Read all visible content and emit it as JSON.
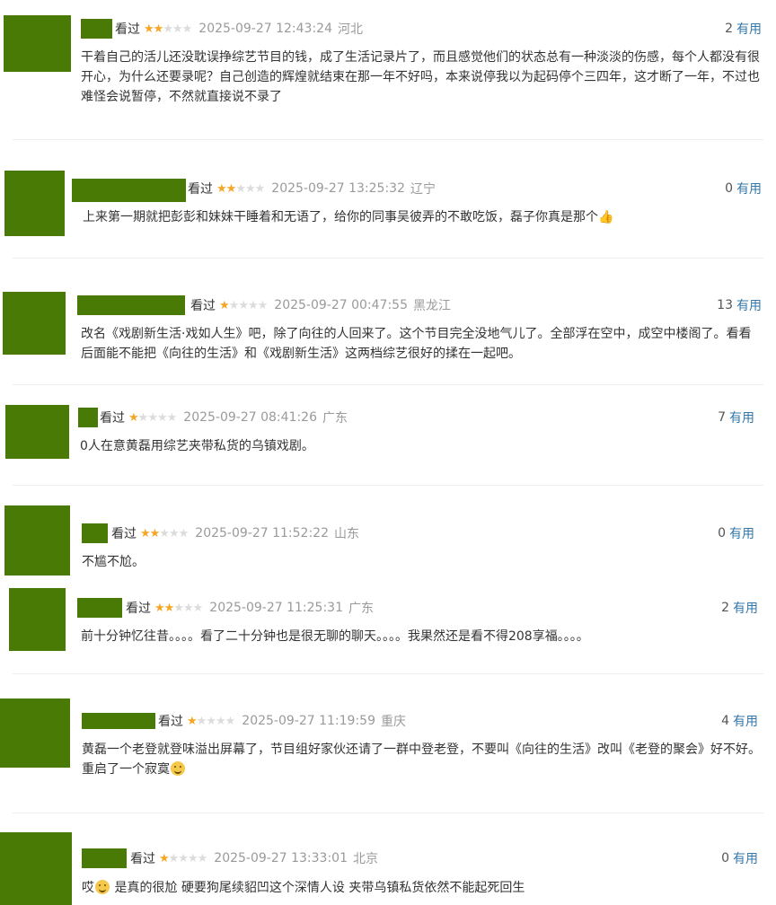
{
  "comments": [
    {
      "status": "看过",
      "rating": 2,
      "time": "2025-09-27 12:43:24",
      "location": "河北",
      "votes": "2",
      "vote_label": "有用",
      "text": "干着自己的活儿还没耽误挣综艺节目的钱，成了生活记录片了，而且感觉他们的状态总有一种淡淡的伤感，每个人都没有很开心，为什么还要录呢？自己创造的辉煌就结束在那一年不好吗，本来说停我以为起码停个三四年，这才断了一年，不过也难怪会说暂停，不然就直接说不录了"
    },
    {
      "status": "看过",
      "rating": 2,
      "time": "2025-09-27 13:25:32",
      "location": "辽宁",
      "votes": "0",
      "vote_label": "有用",
      "text": "上来第一期就把彭彭和妹妹干睡着和无语了，给你的同事吴彼弄的不敢吃饭，磊子你真是那个",
      "emoji": "thumbs-up"
    },
    {
      "status": "看过",
      "rating": 1,
      "time": "2025-09-27 00:47:55",
      "location": "黑龙江",
      "votes": "13",
      "vote_label": "有用",
      "text": "改名《戏剧新生活·戏如人生》吧，除了向往的人回来了。这个节目完全没地气儿了。全部浮在空中，成空中楼阁了。看看后面能不能把《向往的生活》和《戏剧新生活》这两档综艺很好的揉在一起吧。"
    },
    {
      "status": "看过",
      "rating": 1,
      "time": "2025-09-27 08:41:26",
      "location": "广东",
      "votes": "7",
      "vote_label": "有用",
      "text": "0人在意黄磊用综艺夹带私货的乌镇戏剧。"
    },
    {
      "status": "看过",
      "rating": 2,
      "time": "2025-09-27 11:52:22",
      "location": "山东",
      "votes": "0",
      "vote_label": "有用",
      "text": "不尴不尬。"
    },
    {
      "status": "看过",
      "rating": 2,
      "time": "2025-09-27 11:25:31",
      "location": "广东",
      "votes": "2",
      "vote_label": "有用",
      "text": "前十分钟忆往昔。。。。看了二十分钟也是很无聊的聊天。。。。我果然还是看不得208享福。。。。"
    },
    {
      "status": "看过",
      "rating": 1,
      "time": "2025-09-27 11:19:59",
      "location": "重庆",
      "votes": "4",
      "vote_label": "有用",
      "text": "黄磊一个老登就登味溢出屏幕了，节目组好家伙还请了一群中登老登，不要叫《向往的生活》改叫《老登的聚会》好不好。重启了一个寂寞",
      "emoji": "rofl-face"
    },
    {
      "status": "看过",
      "rating": 1,
      "time": "2025-09-27 13:33:01",
      "location": "北京",
      "votes": "0",
      "vote_label": "有用",
      "text_before": "哎",
      "emoji": "expressionless-face",
      "text": " 是真的很尬 硬要狗尾续貂凹这个深情人设 夹带乌镇私货依然不能起死回生"
    }
  ],
  "colors": {
    "avatar": "#4a7a06",
    "star_on": "#f5a623",
    "star_off": "#dcdcdc",
    "meta": "#9a9a9a",
    "vote_label": "#3377aa"
  }
}
